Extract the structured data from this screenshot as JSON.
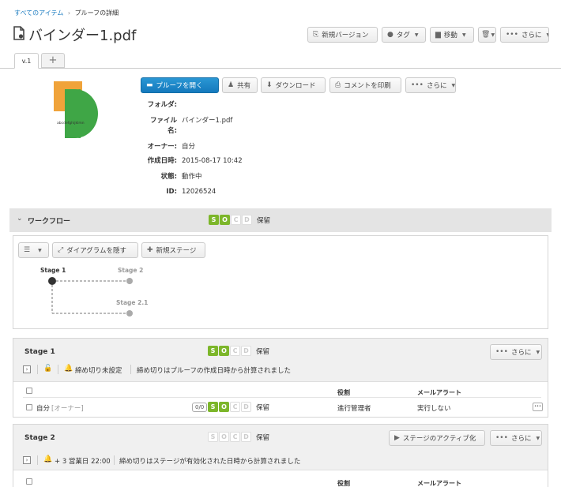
{
  "breadcrumb": {
    "root": "すべてのアイテム",
    "sep": "›",
    "current": "プルーフの詳細"
  },
  "title": "バインダー1.pdf",
  "top_actions": {
    "new_version": "新規バージョン",
    "tag": "タグ",
    "move": "移動",
    "more": "さらに"
  },
  "tabs": {
    "version": "v.1",
    "add": "+"
  },
  "thumbnail_text": "abcdefghijklmn",
  "proof_actions": {
    "open": "プルーフを開く",
    "share": "共有",
    "download": "ダウンロード",
    "print_comments": "コメントを印刷",
    "more": "さらに"
  },
  "meta": {
    "folder_label": "フォルダ:",
    "folder_value": "",
    "filename_label_1": "ファイル",
    "filename_label_2": "名:",
    "filename_value": "バインダー1.pdf",
    "owner_label": "オーナー:",
    "owner_value": "自分",
    "created_label": "作成日時:",
    "created_value": "2015-08-17 10:42",
    "state_label": "状態:",
    "state_value": "動作中",
    "id_label": "ID:",
    "id_value": "12026524"
  },
  "workflow": {
    "title": "ワークフロー",
    "status_text": "保留",
    "letters": [
      "S",
      "O",
      "C",
      "D"
    ],
    "toolbar": {
      "hide_diagram": "ダイアグラムを隠す",
      "new_stage": "新規ステージ"
    },
    "diagram": {
      "stage1": "Stage 1",
      "stage2": "Stage 2",
      "stage21": "Stage 2.1"
    }
  },
  "stage1": {
    "title": "Stage 1",
    "status_text": "保留",
    "more": "さらに",
    "deadline_unset": "締め切り未設定",
    "deadline_note": "締め切りはプルーフの作成日時から計算されました",
    "col_role": "役割",
    "col_alert": "メールアラート",
    "row": {
      "name": "自分",
      "tag": "[オーナー]",
      "count": "0/0",
      "status": "保留",
      "role": "進行管理者",
      "alert": "実行しない",
      "menu": "•••"
    }
  },
  "stage2": {
    "title": "Stage 2",
    "status_text": "保留",
    "activate": "ステージのアクティブ化",
    "more": "さらに",
    "deadline": "+ 3 営業日 22:00",
    "deadline_note": "締め切りはステージが有効化された日時から計算されました",
    "col_role": "役割",
    "col_alert": "メールアラート"
  }
}
